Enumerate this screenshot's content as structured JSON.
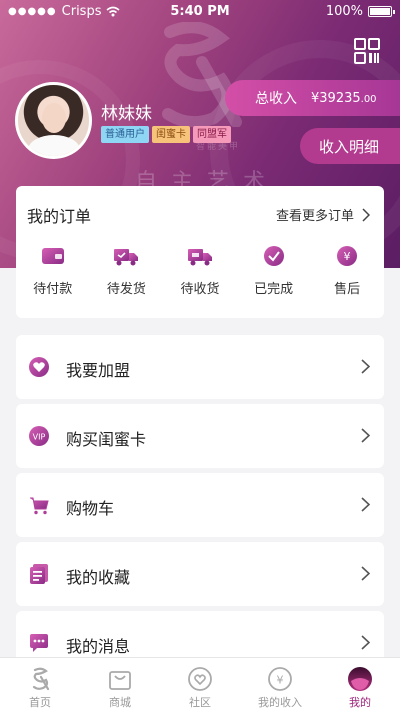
{
  "status_bar": {
    "carrier": "Crisps",
    "time": "5:40 PM",
    "battery": "100%"
  },
  "header": {
    "watermark_text": "自主艺术",
    "watermark_small": "智能美甲",
    "username": "林妹妹",
    "tags": [
      "普通用户",
      "闺蜜卡",
      "同盟军"
    ],
    "income_label": "总收入",
    "income_value": "¥39235",
    "income_decimal": ".00",
    "income_detail": "收入明细"
  },
  "orders": {
    "title": "我的订单",
    "more": "查看更多订单",
    "items": [
      {
        "label": "待付款",
        "icon": "wallet-icon"
      },
      {
        "label": "待发货",
        "icon": "truck-icon"
      },
      {
        "label": "待收货",
        "icon": "delivery-icon"
      },
      {
        "label": "已完成",
        "icon": "check-icon"
      },
      {
        "label": "售后",
        "icon": "yen-icon"
      }
    ]
  },
  "menu": [
    {
      "label": "我要加盟",
      "icon": "heart-badge-icon"
    },
    {
      "label": "购买闺蜜卡",
      "icon": "vip-icon"
    },
    {
      "label": "购物车",
      "icon": "cart-icon"
    },
    {
      "label": "我的收藏",
      "icon": "collection-icon"
    },
    {
      "label": "我的消息",
      "icon": "message-icon"
    }
  ],
  "tabbar": [
    {
      "label": "首页",
      "active": false
    },
    {
      "label": "商城",
      "active": false
    },
    {
      "label": "社区",
      "active": false
    },
    {
      "label": "我的收入",
      "active": false
    },
    {
      "label": "我的",
      "active": true
    }
  ],
  "colors": {
    "accent": "#a0267c",
    "header_start": "#c96a9b",
    "header_end": "#5b1d63"
  }
}
